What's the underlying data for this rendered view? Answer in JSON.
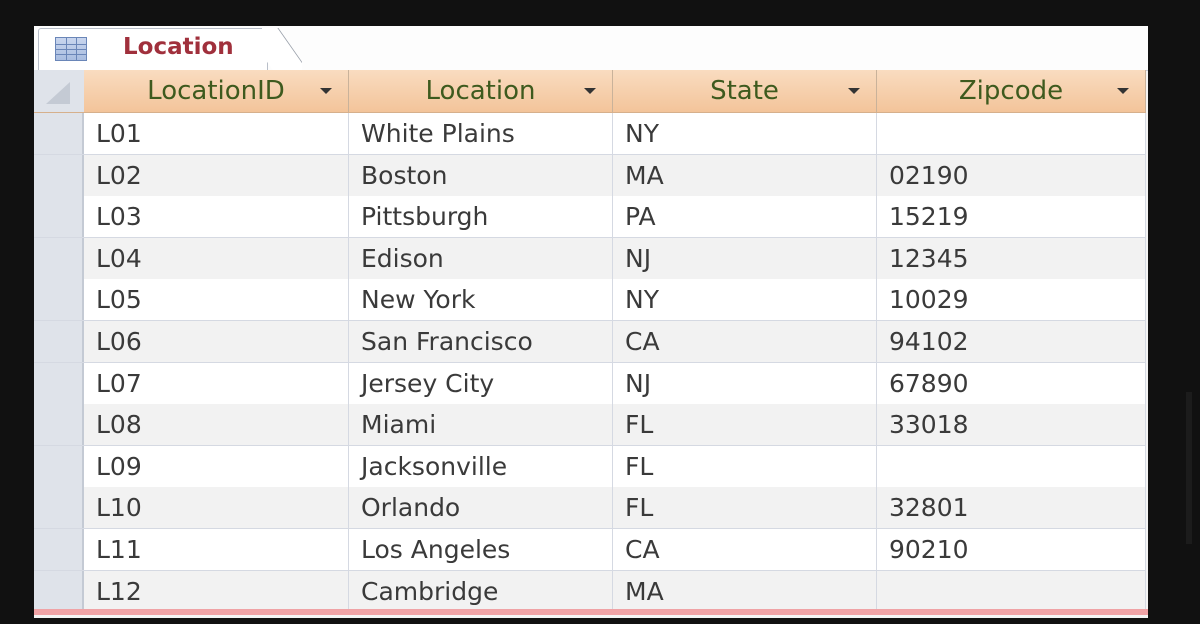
{
  "tab": {
    "label": "Location",
    "icon": "table-icon"
  },
  "columns": [
    {
      "label": "LocationID"
    },
    {
      "label": "Location"
    },
    {
      "label": "State"
    },
    {
      "label": "Zipcode"
    }
  ],
  "rows": [
    {
      "id": "L01",
      "location": "White Plains",
      "state": "NY",
      "zip": ""
    },
    {
      "id": "L02",
      "location": "Boston",
      "state": "MA",
      "zip": "02190"
    },
    {
      "id": "L03",
      "location": "Pittsburgh",
      "state": "PA",
      "zip": "15219"
    },
    {
      "id": "L04",
      "location": "Edison",
      "state": "NJ",
      "zip": "12345"
    },
    {
      "id": "L05",
      "location": "New York",
      "state": "NY",
      "zip": "10029"
    },
    {
      "id": "L06",
      "location": "San Francisco",
      "state": "CA",
      "zip": "94102"
    },
    {
      "id": "L07",
      "location": "Jersey City",
      "state": "NJ",
      "zip": "67890"
    },
    {
      "id": "L08",
      "location": "Miami",
      "state": "FL",
      "zip": "33018"
    },
    {
      "id": "L09",
      "location": "Jacksonville",
      "state": "FL",
      "zip": ""
    },
    {
      "id": "L10",
      "location": "Orlando",
      "state": "FL",
      "zip": "32801"
    },
    {
      "id": "L11",
      "location": "Los Angeles",
      "state": "CA",
      "zip": "90210"
    },
    {
      "id": "L12",
      "location": "Cambridge",
      "state": "MA",
      "zip": ""
    }
  ]
}
